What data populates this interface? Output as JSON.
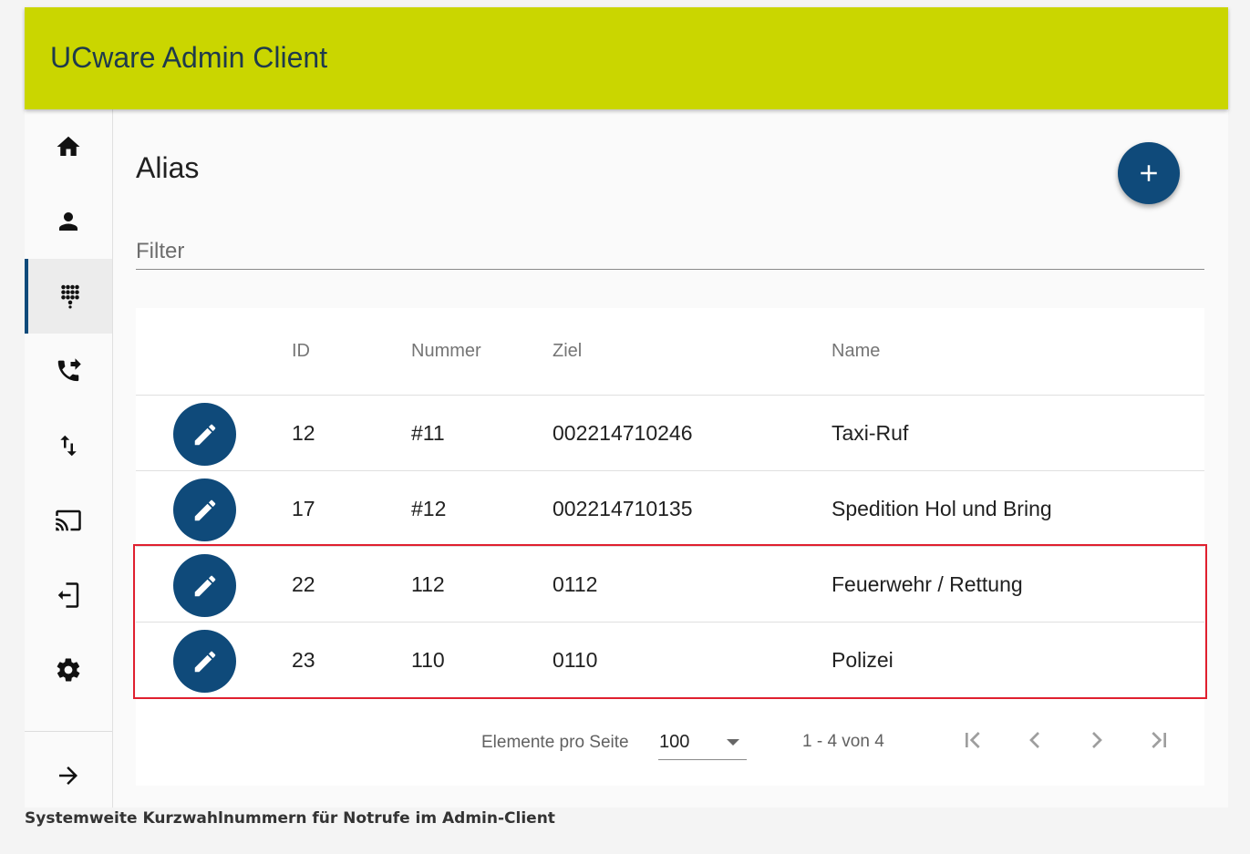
{
  "app": {
    "title": "UCware Admin Client"
  },
  "sidebar": {
    "items": [
      {
        "id": "home",
        "icon": "home-icon"
      },
      {
        "id": "users",
        "icon": "person-icon"
      },
      {
        "id": "alias",
        "icon": "dialpad-icon",
        "active": true
      },
      {
        "id": "forwarding",
        "icon": "phone-forward-icon"
      },
      {
        "id": "routing",
        "icon": "swap-vert-icon"
      },
      {
        "id": "cast",
        "icon": "cast-icon"
      },
      {
        "id": "login",
        "icon": "login-icon"
      },
      {
        "id": "settings",
        "icon": "gear-icon"
      }
    ],
    "collapse_icon": "arrow-right-icon"
  },
  "page": {
    "title": "Alias",
    "filter_placeholder": "Filter",
    "fab_icon": "plus-icon"
  },
  "table": {
    "columns": [
      "ID",
      "Nummer",
      "Ziel",
      "Name"
    ],
    "rows": [
      {
        "id": "12",
        "nummer": "#11",
        "ziel": "002214710246",
        "name": "Taxi-Ruf"
      },
      {
        "id": "17",
        "nummer": "#12",
        "ziel": "002214710135",
        "name": "Spedition Hol und Bring"
      },
      {
        "id": "22",
        "nummer": "112",
        "ziel": "0112",
        "name": "Feuerwehr / Rettung"
      },
      {
        "id": "23",
        "nummer": "110",
        "ziel": "0110",
        "name": "Polizei"
      }
    ]
  },
  "paginator": {
    "label": "Elemente pro Seite",
    "page_size": "100",
    "range": "1 - 4 von 4"
  },
  "colors": {
    "header": "#cad600",
    "primary": "#0f4a7a",
    "highlight": "#e0202f"
  },
  "caption": "Systemweite Kurzwahlnummern für Notrufe im Admin-Client"
}
